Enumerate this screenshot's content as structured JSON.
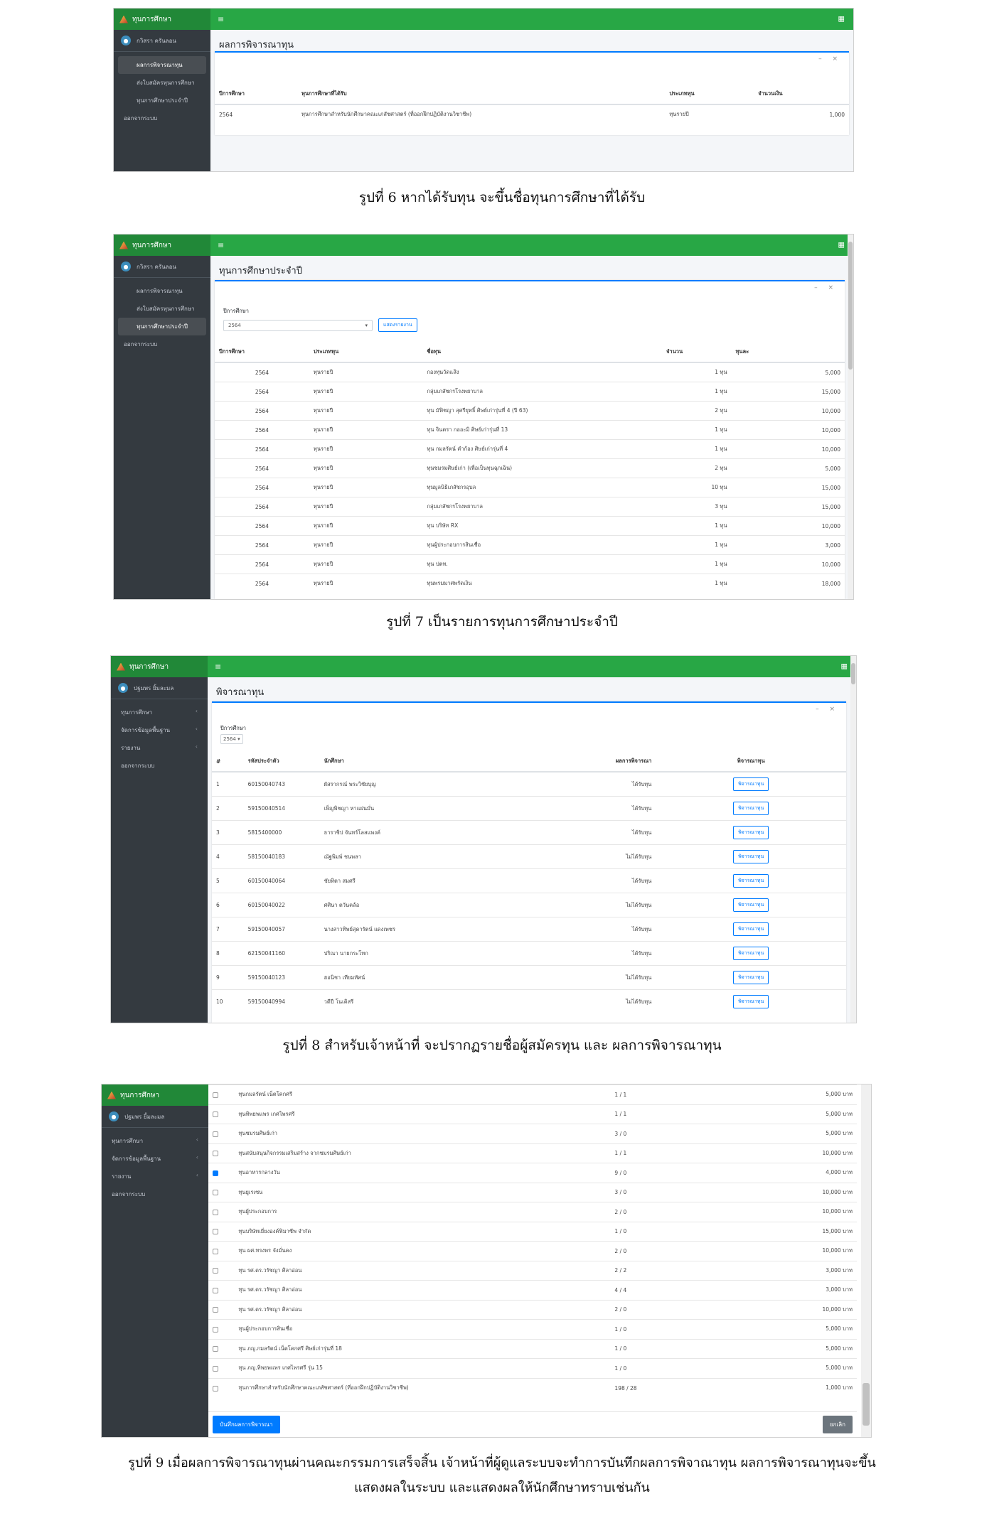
{
  "brand": {
    "title": "ทุนการศึกษา",
    "menu_icon": "hamburger-icon",
    "grid_icon": "grid-icon",
    "logo_icon": "logo-icon",
    "avatar_icon": "user-avatar-icon"
  },
  "captions": {
    "fig6": "รูปที่ 6 หากได้รับทุน จะขึ้นชื่อทุนการศึกษาที่ได้รับ",
    "fig7": "รูปที่ 7 เป็นรายการทุนการศึกษาประจำปี",
    "fig8": "รูปที่ 8  สำหรับเจ้าหน้าที่ จะปรากฏรายชื่อผู้สมัครทุน และ ผลการพิจารณาทุน",
    "fig9_line1": "รูปที่ 9 เมื่อผลการพิจารณาทุนผ่านคณะกรรมการเสร็จสิ้น เจ้าหน้าที่ผู้ดูแลระบบจะทำการบันทึกผลการพิจาณาทุน ผลการพิจารณาทุนจะขึ้น",
    "fig9_line2": "แสดงผลในระบบ และแสดงผลให้นักศึกษาทราบเช่นกัน"
  },
  "student_sidebar": {
    "user": "กวิสรา ครันลอน",
    "items": [
      "ผลการพิจารณาทุน",
      "ส่งใบสมัครทุนการศึกษา",
      "ทุนการศึกษาประจำปี",
      "ออกจากระบบ"
    ]
  },
  "staff_sidebar": {
    "user": "ปฐมพร ยิ้มละมล",
    "items": [
      "ทุนการศึกษา",
      "จัดการข้อมูลพื้นฐาน",
      "รายงาน",
      "ออกจากระบบ"
    ]
  },
  "fig6": {
    "title": "ผลการพิจารณาทุน",
    "columns": [
      "ปีการศึกษา",
      "ทุนการศึกษาที่ได้รับ",
      "ประเภททุน",
      "จำนวนเงิน"
    ],
    "rows": [
      [
        "2564",
        "ทุนการศึกษาสำหรับนักศึกษาคณะเภสัชศาสตร์ (ที่ออกฝึกปฏิบัติงานวิชาชีพ)",
        "ทุนรายปี",
        "1,000"
      ]
    ]
  },
  "fig7": {
    "title": "ทุนการศึกษาประจำปี",
    "filter_label": "ปีการศึกษา",
    "filter_value": "2564",
    "show_button": "แสดงรายงาน",
    "columns": [
      "ปีการศึกษา",
      "ประเภททุน",
      "ชื่อทุน",
      "จำนวน",
      "ทุนละ"
    ],
    "rows": [
      [
        "2564",
        "ทุนรายปี",
        "กองทุนวัดเเสิง",
        "1 ทุน",
        "5,000"
      ],
      [
        "2564",
        "ทุนรายปี",
        "กลุ่มเภสัชกรโรงพยาบาล",
        "1 ทุน",
        "15,000"
      ],
      [
        "2564",
        "ทุนรายปี",
        "ทุน มัฟิชญา สุศรียุทธิ์ ศิษย์เก่ารุ่นที่ 4 (ปี 63)",
        "2 ทุน",
        "10,000"
      ],
      [
        "2564",
        "ทุนรายปี",
        "ทุน จินตรา กออะมิ ศิษย์เก่ารุ่นที่ 13",
        "1 ทุน",
        "10,000"
      ],
      [
        "2564",
        "ทุนรายปี",
        "ทุน กมลรัตน์ คำก้อง ศิษย์เก่ารุ่นที่ 4",
        "1 ทุน",
        "10,000"
      ],
      [
        "2564",
        "ทุนรายปี",
        "ทุนชมรมศิษย์เก่า (เพื่อเป็นทุนฉุกเฉิน)",
        "2 ทุน",
        "5,000"
      ],
      [
        "2564",
        "ทุนรายปี",
        "ทุนมูลนิธิเภสัชกรอุบล",
        "10 ทุน",
        "15,000"
      ],
      [
        "2564",
        "ทุนรายปี",
        "กลุ่มเภสัชกรโรงพยาบาล",
        "3 ทุน",
        "15,000"
      ],
      [
        "2564",
        "ทุนรายปี",
        "ทุน บริษัท RX",
        "1 ทุน",
        "10,000"
      ],
      [
        "2564",
        "ทุนรายปี",
        "ทุนผู้ประกอบการสินเชื่อ",
        "1 ทุน",
        "3,000"
      ],
      [
        "2564",
        "ทุนรายปี",
        "ทุน ปตท.",
        "1 ทุน",
        "10,000"
      ],
      [
        "2564",
        "ทุนรายปี",
        "ทุนพรมมาศพรัดเงิน",
        "1 ทุน",
        "18,000"
      ]
    ]
  },
  "fig8": {
    "title": "พิจารณาทุน",
    "filter_label": "ปีการศึกษา",
    "filter_value": "2564",
    "columns": [
      "#",
      "รหัสประจำตัว",
      "นักศึกษา",
      "ผลการพิจารณา",
      "พิจารณาทุน"
    ],
    "button_label": "พิจารณาทุน",
    "rows": [
      [
        "1",
        "60150040743",
        "ผัสรากรณ์ พระวิชัยบุญ",
        "ได้รับทุน"
      ],
      [
        "2",
        "59150040514",
        "เพ็ญพิชญา หาแผ่นมั่น",
        "ได้รับทุน"
      ],
      [
        "3",
        "5815400000",
        "ธาราชิป จันทร์โลสแพงค์",
        "ได้รับทุน"
      ],
      [
        "4",
        "58150040183",
        "ณัฐพิมพ์ ชนพลา",
        "ไม่ได้รับทุน"
      ],
      [
        "5",
        "60150040064",
        "ชัยทิตา สมศรี",
        "ได้รับทุน"
      ],
      [
        "6",
        "60150040022",
        "ศศินา ตวันคล้อ",
        "ไม่ได้รับทุน"
      ],
      [
        "7",
        "59150040057",
        "นางสาวทิพย์สุดารัตน์ แดงเพชร",
        "ได้รับทุน"
      ],
      [
        "8",
        "62150041160",
        "ปริณา นายกระโทก",
        "ได้รับทุน"
      ],
      [
        "9",
        "59150040123",
        "ฮอนิชา เทียมทัศน์",
        "ไม่ได้รับทุน"
      ],
      [
        "10",
        "59150040994",
        "วดีปี โนเคิสรี",
        "ไม่ได้รับทุน"
      ]
    ]
  },
  "fig9": {
    "unit": "บาท",
    "rows": [
      {
        "name": "ทุนกมลรัตน์ เน็ตโคกศรี",
        "ratio": "1 / 1",
        "amount": "5,000",
        "checked": false
      },
      {
        "name": "ทุนทิพยพแพร เกศไพรศรี",
        "ratio": "1 / 1",
        "amount": "5,000",
        "checked": false
      },
      {
        "name": "ทุนชมรมศิษย์เก่า",
        "ratio": "3 / 0",
        "amount": "5,000",
        "checked": false
      },
      {
        "name": "ทุนสนับสนุนกิจกรรมเสริมสร้าง จากชมรมศิษย์เก่า",
        "ratio": "1 / 1",
        "amount": "10,000",
        "checked": false
      },
      {
        "name": "ทุนอาหารกลางวัน",
        "ratio": "9 / 0",
        "amount": "4,000",
        "checked": true
      },
      {
        "name": "ทุนยูเรเซน",
        "ratio": "3 / 0",
        "amount": "10,000",
        "checked": false
      },
      {
        "name": "ทุนผู้ประกอบการ",
        "ratio": "2 / 0",
        "amount": "10,000",
        "checked": false
      },
      {
        "name": "ทุนบริษัทเยี่ยงองค์ฟิมาซีพ จำกัด",
        "ratio": "1 / 0",
        "amount": "15,000",
        "checked": false
      },
      {
        "name": "ทุน ผศ.ทรงพร จังมั่นคง",
        "ratio": "2 / 0",
        "amount": "10,000",
        "checked": false
      },
      {
        "name": "ทุน รศ.ดร.วรัชญา ศิลาอ่อน",
        "ratio": "2 / 2",
        "amount": "3,000",
        "checked": false
      },
      {
        "name": "ทุน รศ.ดร.วรัชญา ศิลาอ่อน",
        "ratio": "4 / 4",
        "amount": "3,000",
        "checked": false
      },
      {
        "name": "ทุน รศ.ดร.วรัชญา ศิลาอ่อน",
        "ratio": "2 / 0",
        "amount": "10,000",
        "checked": false
      },
      {
        "name": "ทุนผู้ประกอบการสินเชื่อ",
        "ratio": "1 / 0",
        "amount": "5,000",
        "checked": false
      },
      {
        "name": "ทุน ภญ.กมลรัตน์ เน็ตโคกศรี ศิษย์เก่ารุ่นที่ 18",
        "ratio": "1 / 0",
        "amount": "5,000",
        "checked": false
      },
      {
        "name": "ทุน ภญ.ทิพยพแพร เกศไพรศรี รุ่น 15",
        "ratio": "1 / 0",
        "amount": "5,000",
        "checked": false
      },
      {
        "name": "ทุนการศึกษาสำหรับนักศึกษาคณะเภสัชศาสตร์ (ที่ออกฝึกปฏิบัติงานวิชาชีพ)",
        "ratio": "198 / 28",
        "amount": "1,000",
        "checked": false
      }
    ],
    "save_button": "บันทึกผลการพิจารณา",
    "cancel_button": "ยกเลิก"
  }
}
